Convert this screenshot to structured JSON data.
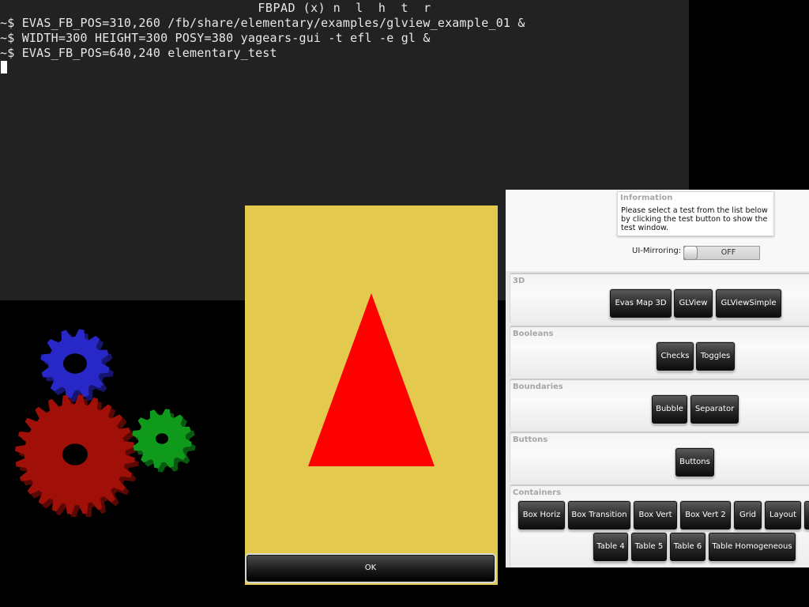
{
  "terminal": {
    "title": "FBPAD (x) n  l  h  t  r",
    "lines": [
      "~$ EVAS_FB_POS=310,260 /fb/share/elementary/examples/glview_example_01 &",
      "~$ WIDTH=300 HEIGHT=300 POSY=380 yagears-gui -t efl -e gl &",
      "~$ EVAS_FB_POS=640,240 elementary_test"
    ]
  },
  "gears": {
    "colors": {
      "red": "#a01008",
      "green": "#0f9a1c",
      "blue": "#2828c8"
    }
  },
  "glview": {
    "background": "#e4c94f",
    "triangle_color": "#ff0000",
    "ok_label": "OK"
  },
  "elementary_test": {
    "info_title": "Information",
    "info_text": "Please select a test from the list below by clicking the test button to show the test window.",
    "mirroring_label": "UI-Mirroring:",
    "mirroring_state": "OFF",
    "sections": [
      {
        "title": "3D",
        "buttons": [
          "Evas Map 3D",
          "GLView",
          "GLViewSimple"
        ]
      },
      {
        "title": "Booleans",
        "buttons": [
          "Checks",
          "Toggles"
        ]
      },
      {
        "title": "Boundaries",
        "buttons": [
          "Bubble",
          "Separator"
        ]
      },
      {
        "title": "Buttons",
        "buttons": [
          "Buttons"
        ]
      },
      {
        "title": "Containers",
        "buttons": [
          "Box Horiz",
          "Box Transition",
          "Box Vert",
          "Box Vert 2",
          "Grid",
          "Layout",
          "Table 4",
          "Table 5",
          "Table 6",
          "Table Homogeneous"
        ]
      }
    ]
  }
}
